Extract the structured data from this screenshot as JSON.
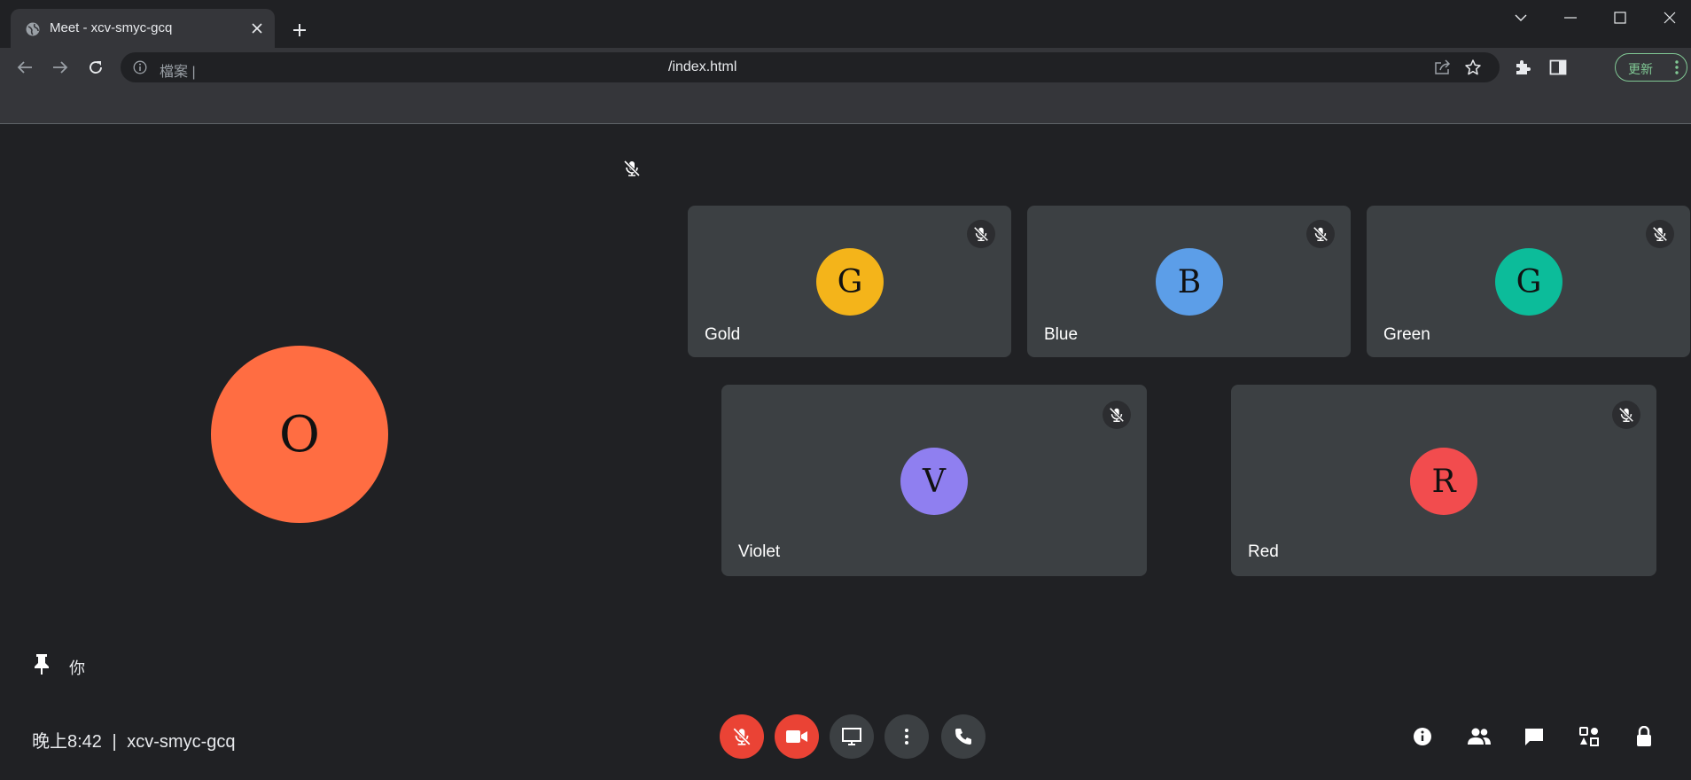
{
  "browser": {
    "tab_title": "Meet - xcv-smyc-gcq",
    "url_scheme_label": "檔案 |",
    "url_path": "/index.html",
    "update_label": "更新"
  },
  "meeting": {
    "self": {
      "initial": "O",
      "label": "你",
      "color": "#ff6d42"
    },
    "participants": [
      {
        "name": "Gold",
        "initial": "G",
        "color": "#f4b41a"
      },
      {
        "name": "Blue",
        "initial": "B",
        "color": "#5c9ee8"
      },
      {
        "name": "Green",
        "initial": "G",
        "color": "#0cbc9a"
      },
      {
        "name": "Violet",
        "initial": "V",
        "color": "#8f7ff0"
      },
      {
        "name": "Red",
        "initial": "R",
        "color": "#f24c4e"
      }
    ],
    "time": "晚上8:42",
    "separator": "|",
    "meeting_code": "xcv-smyc-gcq"
  }
}
